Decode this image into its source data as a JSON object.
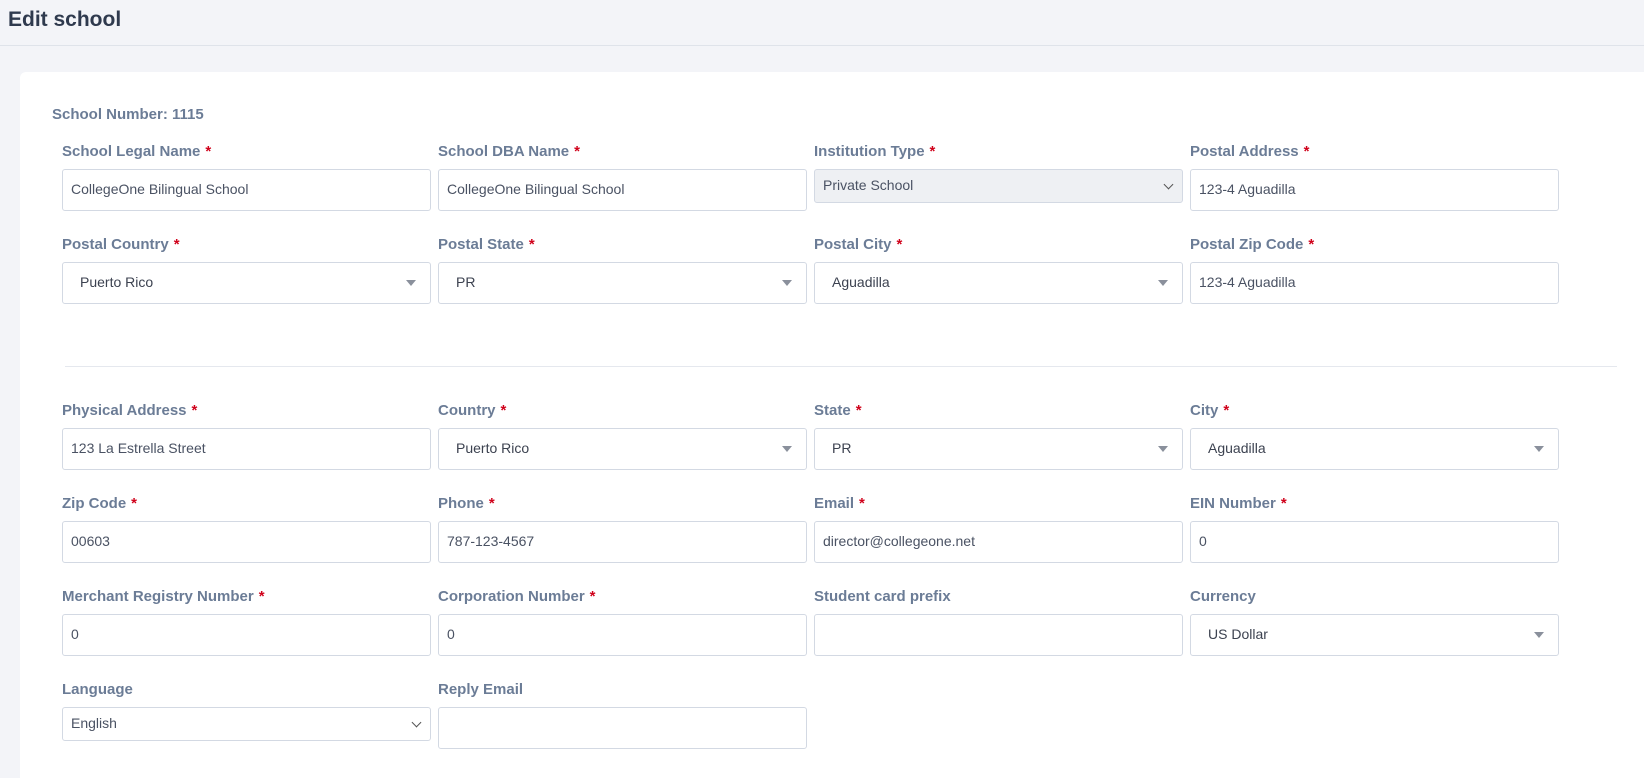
{
  "page": {
    "title": "Edit school"
  },
  "school_number": "School Number: 1115",
  "rows": [
    [
      {
        "label": "School Legal Name",
        "required": true,
        "type": "text",
        "value": "CollegeOne Bilingual School"
      },
      {
        "label": "School DBA Name",
        "required": true,
        "type": "text",
        "value": "CollegeOne Bilingual School"
      },
      {
        "label": "Institution Type",
        "required": true,
        "type": "select-disabled",
        "value": "Private School"
      },
      {
        "label": "Postal Address",
        "required": true,
        "type": "text",
        "value": "123-4 Aguadilla"
      }
    ],
    [
      {
        "label": "Postal Country",
        "required": true,
        "type": "select2",
        "value": "Puerto Rico"
      },
      {
        "label": "Postal State",
        "required": true,
        "type": "select2",
        "value": "PR"
      },
      {
        "label": "Postal City",
        "required": true,
        "type": "select2",
        "value": "Aguadilla"
      },
      {
        "label": "Postal Zip Code",
        "required": true,
        "type": "text",
        "value": "123-4 Aguadilla"
      }
    ],
    [
      {
        "label": "Physical Address",
        "required": true,
        "type": "text",
        "value": "123 La Estrella Street"
      },
      {
        "label": "Country",
        "required": true,
        "type": "select2",
        "value": "Puerto Rico"
      },
      {
        "label": "State",
        "required": true,
        "type": "select2",
        "value": "PR"
      },
      {
        "label": "City",
        "required": true,
        "type": "select2",
        "value": "Aguadilla"
      }
    ],
    [
      {
        "label": "Zip Code",
        "required": true,
        "type": "text",
        "value": "00603"
      },
      {
        "label": "Phone",
        "required": true,
        "type": "text",
        "value": "787-123-4567"
      },
      {
        "label": "Email",
        "required": true,
        "type": "text",
        "value": "director@collegeone.net"
      },
      {
        "label": "EIN Number",
        "required": true,
        "type": "text",
        "value": "0"
      }
    ],
    [
      {
        "label": "Merchant Registry Number",
        "required": true,
        "type": "text",
        "value": "0"
      },
      {
        "label": "Corporation Number",
        "required": true,
        "type": "text",
        "value": "0"
      },
      {
        "label": "Student card prefix",
        "required": false,
        "type": "text",
        "value": ""
      },
      {
        "label": "Currency",
        "required": false,
        "type": "select2",
        "value": "US Dollar"
      }
    ],
    [
      {
        "label": "Language",
        "required": false,
        "type": "select-native",
        "value": "English"
      },
      {
        "label": "Reply Email",
        "required": false,
        "type": "text",
        "value": ""
      }
    ]
  ],
  "required_marker": "*"
}
